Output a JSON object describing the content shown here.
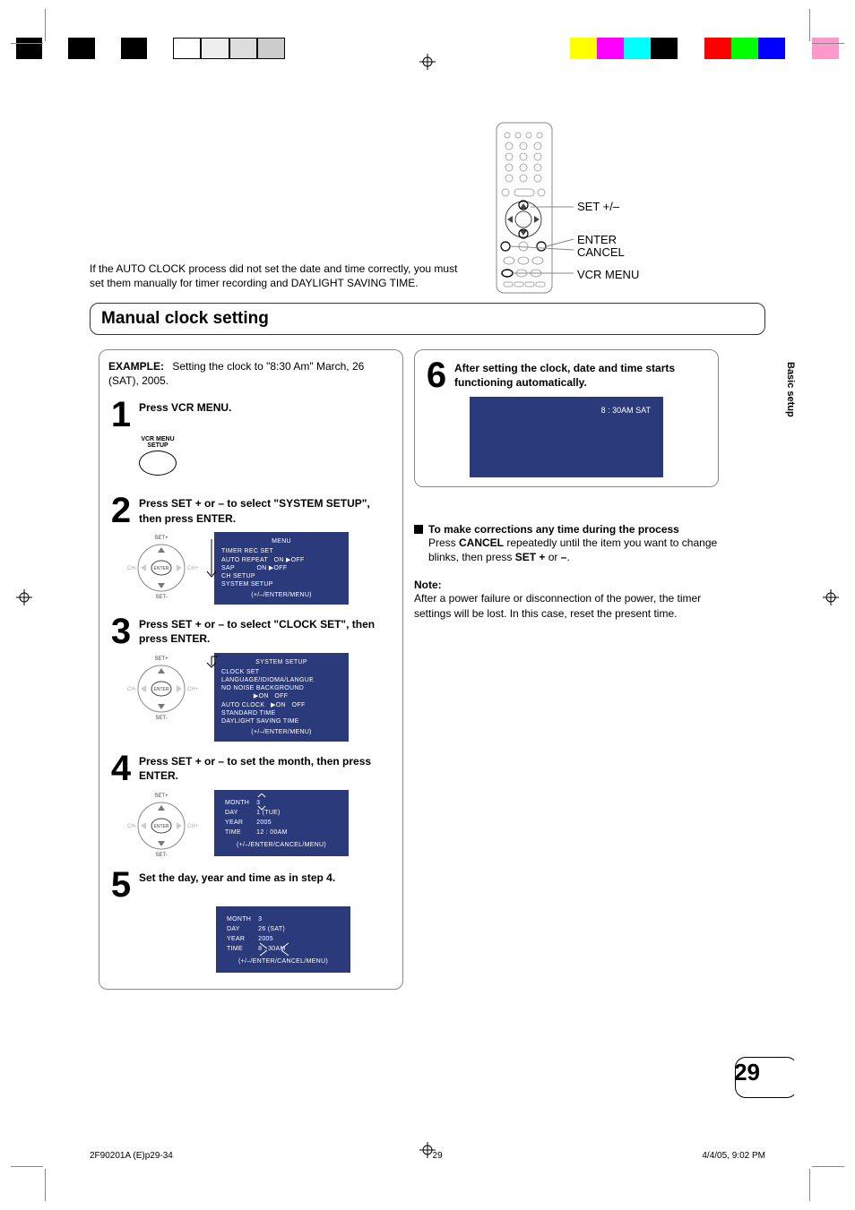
{
  "header": {
    "registration_marks": true
  },
  "remote_labels": {
    "set": "SET +/–",
    "enter": "ENTER",
    "cancel": "CANCEL",
    "vcrmenu": "VCR MENU"
  },
  "intro": "If the AUTO CLOCK process did not set the date and time correctly, you must set them manually for timer recording and DAYLIGHT SAVING TIME.",
  "section_title": "Manual clock setting",
  "example_label": "EXAMPLE:",
  "example_text": "Setting the clock to \"8:30 Am\" March, 26 (SAT), 2005.",
  "steps": [
    {
      "num": "1",
      "text": "Press VCR MENU.",
      "button_caption": "VCR MENU\nSETUP"
    },
    {
      "num": "2",
      "text": "Press SET + or – to select \"SYSTEM SETUP\", then press ENTER."
    },
    {
      "num": "3",
      "text": "Press SET + or – to select \"CLOCK SET\", then press ENTER."
    },
    {
      "num": "4",
      "text": "Press SET + or – to set the month, then press ENTER."
    },
    {
      "num": "5",
      "text": "Set the day, year and time as in step 4."
    },
    {
      "num": "6",
      "text": "After setting the clock, date and time starts functioning automatically."
    }
  ],
  "osd": {
    "menu": {
      "title": "MENU",
      "items": [
        "TIMER REC SET",
        "AUTO REPEAT   ON ▶OFF",
        "SAP           ON ▶OFF",
        "CH SETUP",
        "SYSTEM SETUP"
      ],
      "foot": "(+/–/ENTER/MENU)"
    },
    "system": {
      "title": "SYSTEM SETUP",
      "items": [
        "CLOCK SET",
        "LANGUAGE/IDIOMA/LANGUE",
        "NO NOISE BACKGROUND",
        "                ▶ON   OFF",
        "AUTO CLOCK   ▶ON   OFF",
        "STANDARD TIME",
        "DAYLIGHT SAVING TIME"
      ],
      "foot": "(+/–/ENTER/MENU)"
    },
    "month": {
      "rows": [
        [
          "MONTH",
          "3"
        ],
        [
          "DAY",
          "1 (TUE)"
        ],
        [
          "YEAR",
          "2005"
        ],
        [
          "TIME",
          "12 : 00AM"
        ]
      ],
      "foot": "(+/–/ENTER/CANCEL/MENU)"
    },
    "final": {
      "rows": [
        [
          "MONTH",
          "3"
        ],
        [
          "DAY",
          "26 (SAT)"
        ],
        [
          "YEAR",
          "2005"
        ],
        [
          "TIME",
          "8 : 30AM"
        ]
      ],
      "foot": "(+/–/ENTER/CANCEL/MENU)"
    }
  },
  "vcr_display": "8 : 30AM  SAT",
  "corrections": {
    "head": "To make corrections any time during the process",
    "body_pre": "Press ",
    "body_cancel": "CANCEL",
    "body_mid": " repeatedly until the item you want to change blinks, then press ",
    "body_set": "SET +",
    "body_or": " or ",
    "body_minus": "–",
    "body_end": "."
  },
  "note": {
    "head": "Note:",
    "body": "After a power failure or disconnection of the power, the timer settings will be lost. In this case, reset the present time."
  },
  "side_tab": "Basic setup",
  "page_number": "29",
  "footer": {
    "left": "2F90201A (E)p29-34",
    "mid": "29",
    "right": "4/4/05, 9:02 PM"
  }
}
